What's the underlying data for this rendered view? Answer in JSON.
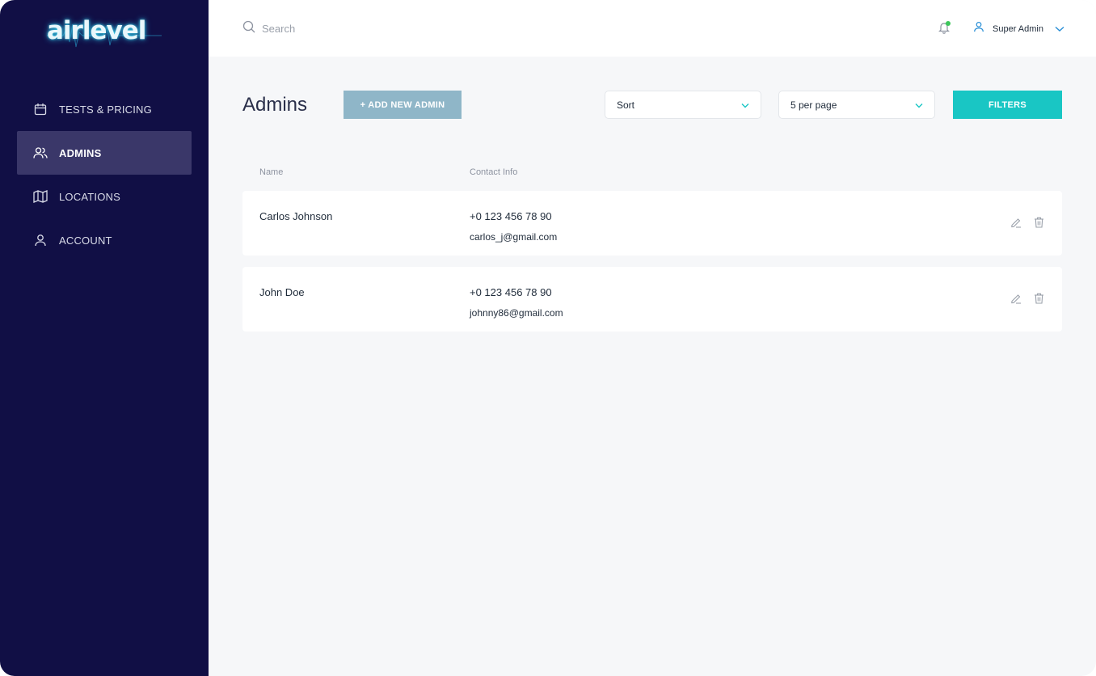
{
  "app": {
    "logo_text": "airlevel"
  },
  "sidebar": {
    "items": [
      {
        "label": "TESTS & PRICING",
        "icon": "calendar-icon",
        "active": false
      },
      {
        "label": "ADMINS",
        "icon": "users-icon",
        "active": true
      },
      {
        "label": "LOCATIONS",
        "icon": "map-icon",
        "active": false
      },
      {
        "label": "ACCOUNT",
        "icon": "user-icon",
        "active": false
      }
    ]
  },
  "header": {
    "search": {
      "placeholder": "Search",
      "value": ""
    },
    "notification_icon": "bell-icon",
    "user": {
      "name": "Super Admin",
      "icon": "user-icon"
    }
  },
  "main": {
    "title": "Admins",
    "add_button_label": "+ ADD NEW ADMIN",
    "sort": {
      "value": "Sort"
    },
    "per_page": {
      "value": "5 per page"
    },
    "filters_label": "FILTERS",
    "columns": [
      "Name",
      "Contact Info"
    ],
    "rows": [
      {
        "name": "Carlos Johnson",
        "phone": "+0 123 456 78 90",
        "email": "carlos_j@gmail.com"
      },
      {
        "name": "John Doe",
        "phone": "+0 123 456 78 90",
        "email": "johnny86@gmail.com"
      }
    ]
  },
  "colors": {
    "sidebar_bg": "#110f45",
    "sidebar_active": "#3a3769",
    "accent_teal": "#19c6c4",
    "add_button": "#8fb6c8",
    "notification_dot": "#3cc65a"
  }
}
